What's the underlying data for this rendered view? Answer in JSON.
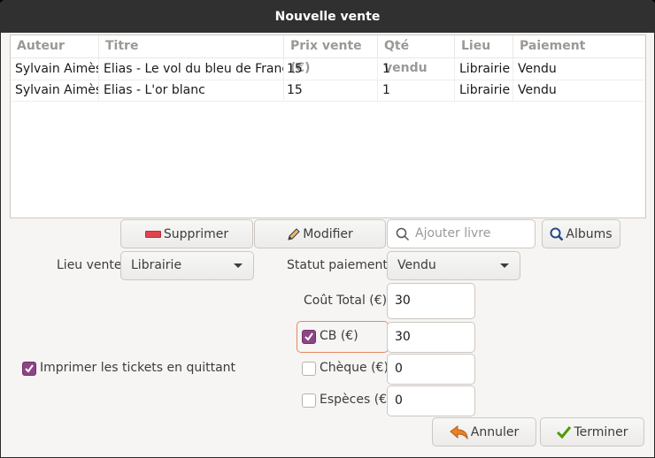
{
  "window": {
    "title": "Nouvelle vente"
  },
  "table": {
    "columns": [
      "Auteur",
      "Titre",
      "Prix vente (€)",
      "Qté vendu",
      "Lieu",
      "Paiement"
    ],
    "rows": [
      [
        "Sylvain Aimès",
        "Elias - Le vol du bleu de France",
        "15",
        "1",
        "Librairie",
        "Vendu"
      ],
      [
        "Sylvain Aimès",
        "Elias - L'or blanc",
        "15",
        "1",
        "Librairie",
        "Vendu"
      ]
    ]
  },
  "toolbar": {
    "delete_label": "Supprimer",
    "edit_label": "Modifier",
    "search_placeholder": "Ajouter livre",
    "albums_label": "Albums"
  },
  "form": {
    "lieu_label": "Lieu vente",
    "lieu_value": "Librairie",
    "statut_label": "Statut paiement",
    "statut_value": "Vendu",
    "cout_label": "Coût Total (€)",
    "cout_value": "30",
    "cb_label": "CB (€)",
    "cb_checked": true,
    "cb_value": "30",
    "cheque_label": "Chèque (€)",
    "cheque_checked": false,
    "cheque_value": "0",
    "especes_label": "Espèces (€)",
    "especes_checked": false,
    "especes_value": "0",
    "print_label": "Imprimer les tickets en quittant",
    "print_checked": true
  },
  "actions": {
    "cancel_label": "Annuler",
    "finish_label": "Terminer"
  },
  "colors": {
    "accent": "#8e4585",
    "focus": "#e8875f",
    "titlebar": "#303030"
  }
}
